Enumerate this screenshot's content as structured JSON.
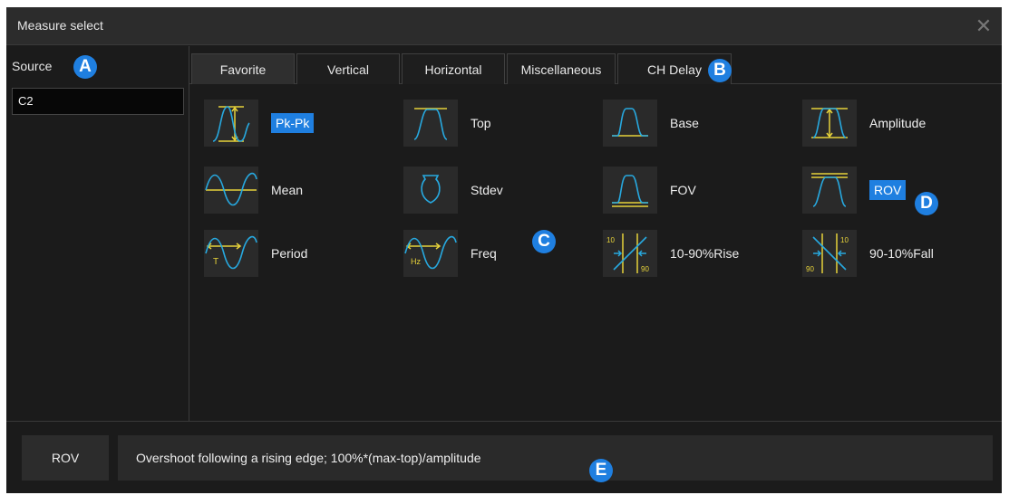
{
  "window": {
    "title": "Measure select",
    "close_symbol": "✕"
  },
  "sidebar": {
    "source_label": "Source",
    "source_value": "C2"
  },
  "tabs": [
    {
      "label": "Favorite",
      "active": true
    },
    {
      "label": "Vertical",
      "active": false
    },
    {
      "label": "Horizontal",
      "active": false
    },
    {
      "label": "Miscellaneous",
      "active": false
    },
    {
      "label": "CH Delay",
      "active": false
    }
  ],
  "measurements": [
    {
      "label": "Pk-Pk",
      "icon": "pk-pk-icon",
      "selected": true
    },
    {
      "label": "Top",
      "icon": "top-icon",
      "selected": false
    },
    {
      "label": "Base",
      "icon": "base-icon",
      "selected": false
    },
    {
      "label": "Amplitude",
      "icon": "amplitude-icon",
      "selected": false
    },
    {
      "label": "Mean",
      "icon": "mean-icon",
      "selected": false
    },
    {
      "label": "Stdev",
      "icon": "stdev-icon",
      "selected": false
    },
    {
      "label": "FOV",
      "icon": "fov-icon",
      "selected": false
    },
    {
      "label": "ROV",
      "icon": "rov-icon",
      "selected": true
    },
    {
      "label": "Period",
      "icon": "period-icon",
      "selected": false
    },
    {
      "label": "Freq",
      "icon": "freq-icon",
      "selected": false
    },
    {
      "label": "10-90%Rise",
      "icon": "rise-time-icon",
      "selected": false
    },
    {
      "label": "90-10%Fall",
      "icon": "fall-time-icon",
      "selected": false
    }
  ],
  "icon_text": {
    "period": "T",
    "freq": "Hz",
    "rise_low": "10",
    "rise_high": "90",
    "fall_high": "10",
    "fall_low": "90"
  },
  "footer": {
    "selected_name": "ROV",
    "description": "Overshoot following a rising edge; 100%*(max-top)/amplitude"
  },
  "markers": {
    "a": "A",
    "b": "B",
    "c": "C",
    "d": "D",
    "e": "E"
  },
  "colors": {
    "accent": "#1f7fe0",
    "waveform": "#27a9e0",
    "guide": "#e6d23a"
  }
}
